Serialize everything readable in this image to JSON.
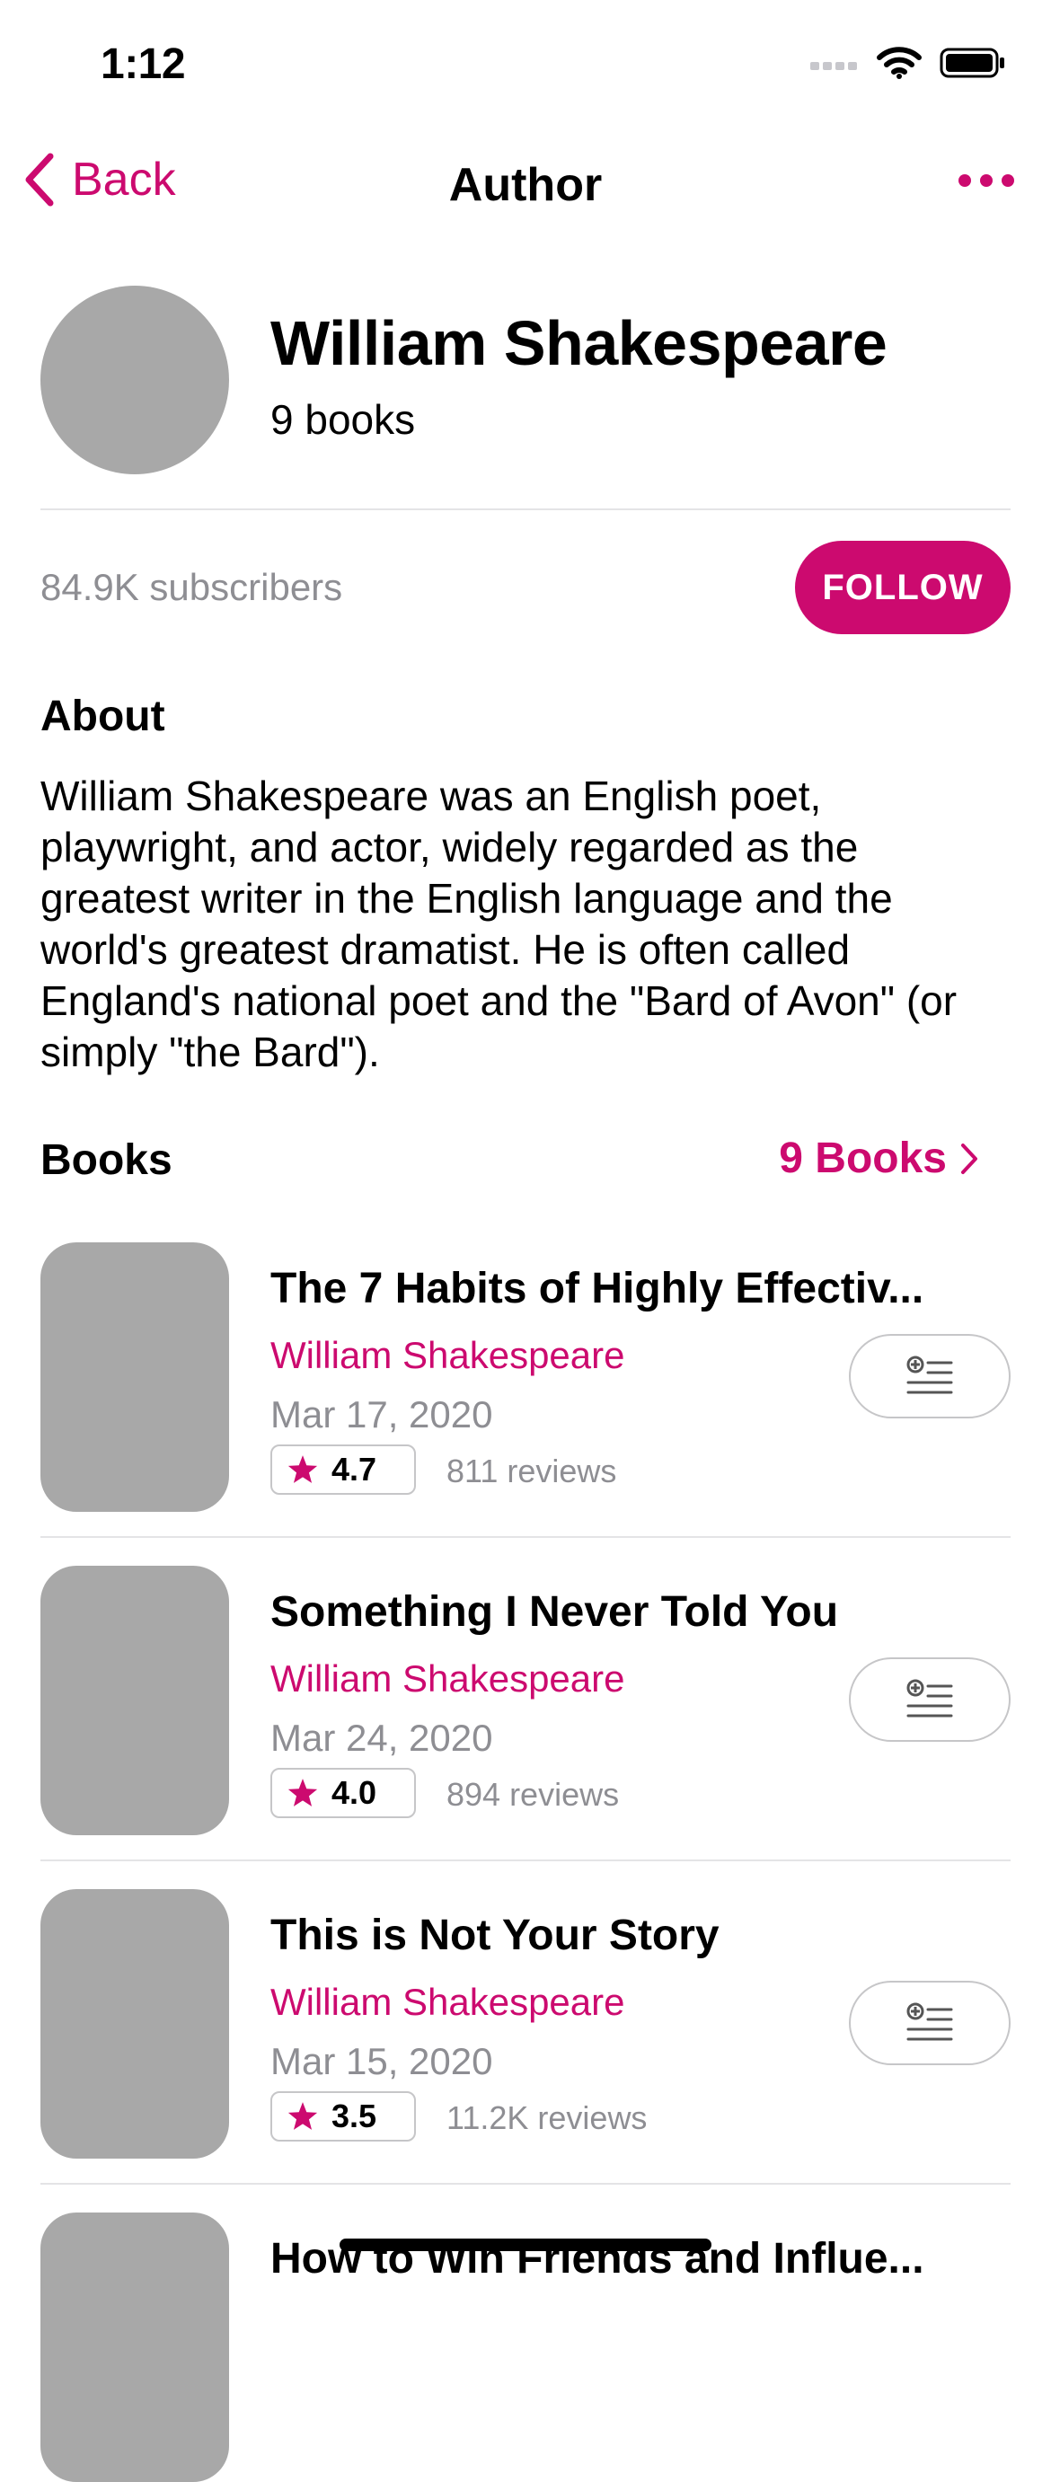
{
  "status_bar": {
    "time": "1:12"
  },
  "nav": {
    "back_label": "Back",
    "title": "Author"
  },
  "author": {
    "name": "William Shakespeare",
    "book_count": "9 books",
    "subscribers": "84.9K subscribers",
    "follow_label": "FOLLOW"
  },
  "about": {
    "heading": "About",
    "text": "William Shakespeare was an English poet, playwright, and actor, widely regarded as the greatest writer in the English language and the world's greatest dramatist. He is often called England's national poet and the \"Bard of Avon\" (or simply \"the Bard\")."
  },
  "books_section": {
    "heading": "Books",
    "link_label": "9 Books"
  },
  "books": [
    {
      "title": "The 7 Habits of Highly Effectiv...",
      "author": "William Shakespeare",
      "date": "Mar 17, 2020",
      "rating": "4.7",
      "reviews": "811 reviews"
    },
    {
      "title": "Something I Never Told You",
      "author": "William Shakespeare",
      "date": "Mar 24, 2020",
      "rating": "4.0",
      "reviews": "894 reviews"
    },
    {
      "title": "This is Not Your Story",
      "author": "William Shakespeare",
      "date": "Mar 15, 2020",
      "rating": "3.5",
      "reviews": "11.2K reviews"
    },
    {
      "title": "How to Win Friends and Influe..."
    }
  ],
  "colors": {
    "accent": "#cc0a6f",
    "placeholder": "#a8a8a8",
    "secondary_text": "#8e8e93"
  },
  "icons": [
    "cellular-signal-icon",
    "wifi-icon",
    "battery-icon",
    "chevron-left-icon",
    "more-icon",
    "chevron-right-icon",
    "star-icon",
    "add-to-list-icon"
  ]
}
